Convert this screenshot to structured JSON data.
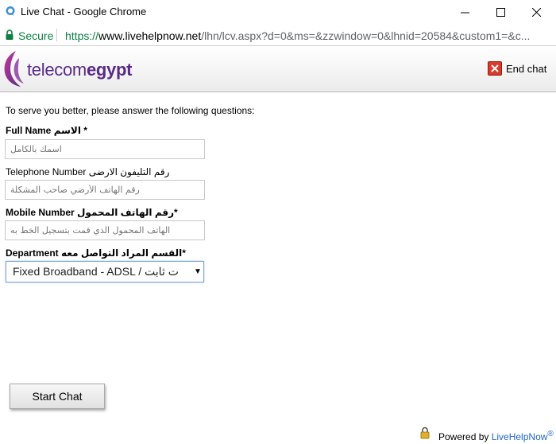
{
  "window": {
    "title": "Live Chat - Google Chrome",
    "minimize_icon": "minimize-icon",
    "maximize_icon": "maximize-icon",
    "close_icon": "close-icon"
  },
  "addressbar": {
    "secure_label": "Secure",
    "url_scheme": "https://",
    "url_host": "www.livehelpnow.net",
    "url_path": "/lhn/lcv.aspx?d=0&ms=&zzwindow=0&lhnid=20584&custom1=&c..."
  },
  "header": {
    "logo_light": "telecom",
    "logo_bold": "egypt",
    "end_chat_label": "End chat"
  },
  "form": {
    "intro": "To serve you better, please answer the following questions:",
    "full_name_label": "Full Name الاسم *",
    "full_name_placeholder": "اسمك بالكامل",
    "telephone_label": "Telephone Number رقم التليفون الارضى",
    "telephone_placeholder": "رقم الهاتف الأرضي صاحب المشكلة",
    "mobile_label": "Mobile Number رقم الهاتف المحمول*",
    "mobile_placeholder": "الهاتف المحمول الذي قمت بتسجيل الخط به",
    "department_label": "Department القسم المراد التواصل معه*",
    "department_value": "Fixed Broadband - ADSL / ت ثابت"
  },
  "actions": {
    "start_chat_label": "Start Chat"
  },
  "footer": {
    "powered_prefix": "Powered by ",
    "powered_link": "LiveHelpNow",
    "powered_mark": "®"
  },
  "colors": {
    "brand_purple": "#5a2b86",
    "secure_green": "#0b8043",
    "link_blue": "#1b66c9",
    "end_chat_red": "#d93a2b"
  }
}
